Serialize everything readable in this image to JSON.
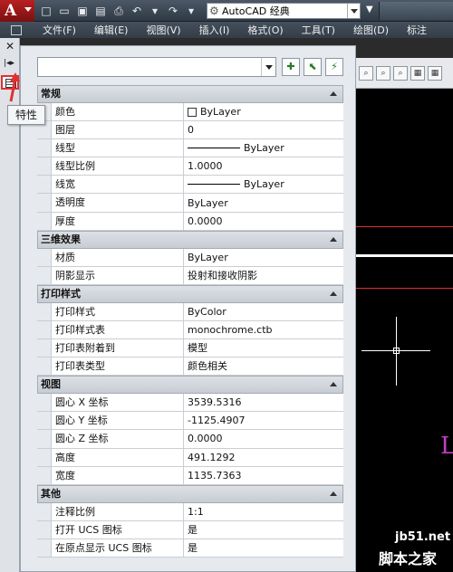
{
  "titlebar": {
    "workspace": "AutoCAD 经典",
    "qat_icons": [
      "new-icon",
      "open-icon",
      "save-icon",
      "saveas-icon",
      "print-icon",
      "undo-icon",
      "undo-dropdown-icon",
      "redo-icon",
      "redo-dropdown-icon"
    ]
  },
  "menubar": {
    "items": [
      "文件(F)",
      "编辑(E)",
      "视图(V)",
      "插入(I)",
      "格式(O)",
      "工具(T)",
      "绘图(D)",
      "标注"
    ]
  },
  "leftstrip": {
    "close_glyph": "✕",
    "autohide_glyph": "|◂▸",
    "tooltip": "特性"
  },
  "panel": {
    "selector_value": "",
    "sections": [
      {
        "title": "常规",
        "rows": [
          {
            "key": "颜色",
            "value": "ByLayer",
            "kind": "color"
          },
          {
            "key": "图层",
            "value": "0"
          },
          {
            "key": "线型",
            "value": "ByLayer",
            "kind": "line"
          },
          {
            "key": "线型比例",
            "value": "1.0000"
          },
          {
            "key": "线宽",
            "value": "ByLayer",
            "kind": "line"
          },
          {
            "key": "透明度",
            "value": "ByLayer"
          },
          {
            "key": "厚度",
            "value": "0.0000"
          }
        ]
      },
      {
        "title": "三维效果",
        "rows": [
          {
            "key": "材质",
            "value": "ByLayer"
          },
          {
            "key": "阴影显示",
            "value": "投射和接收阴影"
          }
        ]
      },
      {
        "title": "打印样式",
        "rows": [
          {
            "key": "打印样式",
            "value": "ByColor"
          },
          {
            "key": "打印样式表",
            "value": "monochrome.ctb"
          },
          {
            "key": "打印表附着到",
            "value": "模型"
          },
          {
            "key": "打印表类型",
            "value": "颜色相关"
          }
        ]
      },
      {
        "title": "视图",
        "rows": [
          {
            "key": "圆心 X 坐标",
            "value": "3539.5316"
          },
          {
            "key": "圆心 Y 坐标",
            "value": "-1125.4907"
          },
          {
            "key": "圆心 Z 坐标",
            "value": "0.0000"
          },
          {
            "key": "高度",
            "value": "491.1292"
          },
          {
            "key": "宽度",
            "value": "1135.7363"
          }
        ]
      },
      {
        "title": "其他",
        "rows": [
          {
            "key": "注释比例",
            "value": "1:1"
          },
          {
            "key": "打开 UCS 图标",
            "value": "是"
          },
          {
            "key": "在原点显示 UCS 图标",
            "value": "是"
          }
        ]
      }
    ]
  },
  "drawing": {
    "label": "L"
  },
  "watermark": {
    "line1": "jb51.net",
    "line2": "脚本之家"
  },
  "colors": {
    "highlight_red": "#e03030",
    "drawing_bg": "#000000",
    "purple_text": "#c040c0"
  }
}
